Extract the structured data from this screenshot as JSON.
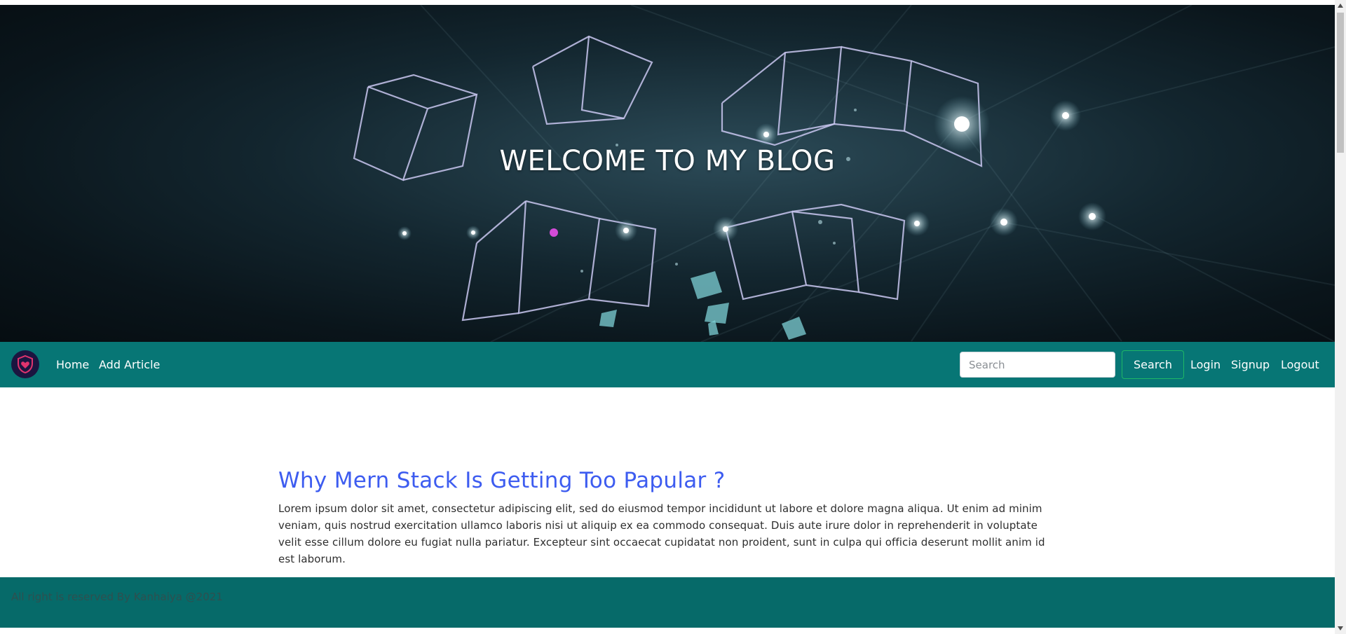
{
  "hero": {
    "title": "WELCOME TO MY BLOG"
  },
  "navbar": {
    "logo_icon": "shield-heart-icon",
    "links": [
      {
        "label": "Home"
      },
      {
        "label": "Add Article"
      }
    ],
    "search": {
      "placeholder": "Search",
      "value": "",
      "button_label": "Search"
    },
    "auth_links": [
      {
        "label": "Login"
      },
      {
        "label": "Signup"
      },
      {
        "label": "Logout"
      }
    ]
  },
  "article": {
    "title": "Why Mern Stack Is Getting Too Papular ?",
    "body": "Lorem ipsum dolor sit amet, consectetur adipiscing elit, sed do eiusmod tempor incididunt ut labore et dolore magna aliqua. Ut enim ad minim veniam, quis nostrud exercitation ullamco laboris nisi ut aliquip ex ea commodo consequat. Duis aute irure dolor in reprehenderit in voluptate velit esse cillum dolore eu fugiat nulla pariatur. Excepteur sint occaecat cupidatat non proident, sunt in culpa qui officia deserunt mollit anim id est laborum."
  },
  "footer": {
    "text": "All right is reserved By Kanhaiya @2021"
  },
  "colors": {
    "navbar": "#077675",
    "footer": "#066a69",
    "article_title": "#3d5cf0",
    "search_button_border": "#1fb866",
    "logo_bg": "#1b1540"
  }
}
